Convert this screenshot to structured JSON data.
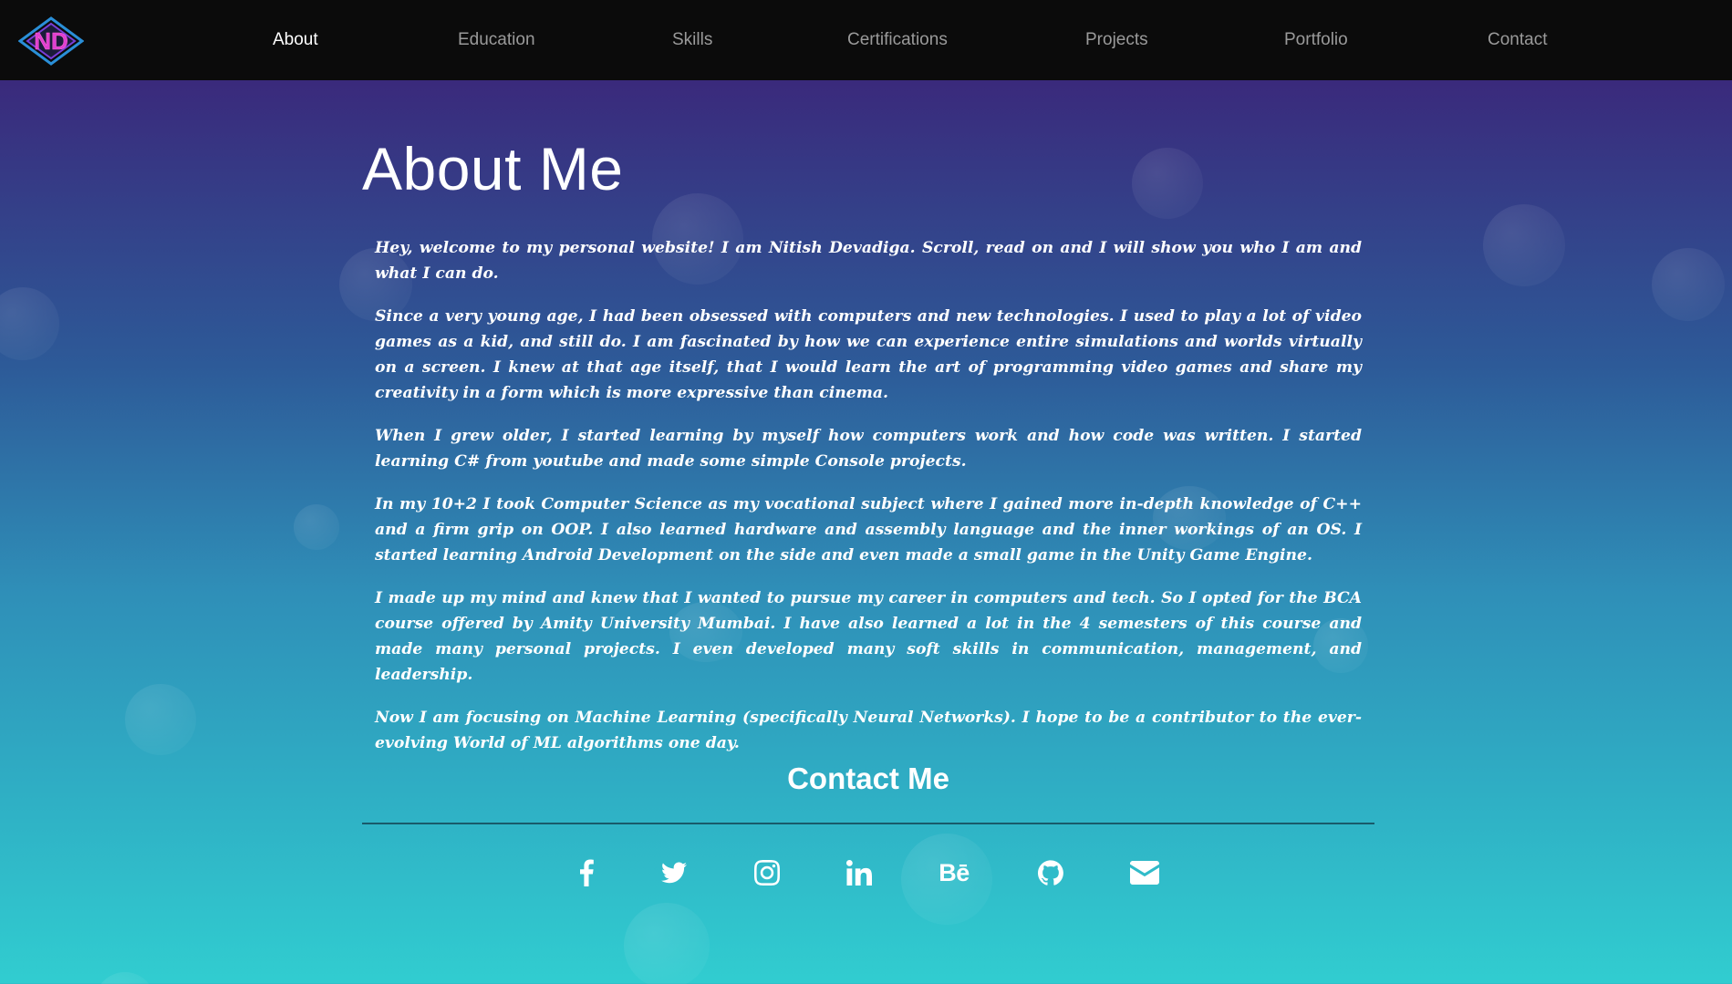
{
  "nav": {
    "logo_text": "ND",
    "items": [
      {
        "label": "About",
        "active": true
      },
      {
        "label": "Education",
        "active": false
      },
      {
        "label": "Skills",
        "active": false
      },
      {
        "label": "Certifications",
        "active": false
      },
      {
        "label": "Projects",
        "active": false
      },
      {
        "label": "Portfolio",
        "active": false
      },
      {
        "label": "Contact",
        "active": false
      }
    ]
  },
  "about": {
    "title": "About Me",
    "paragraphs": [
      "Hey, welcome to my personal website! I am Nitish Devadiga. Scroll, read on and I will show you who I am and what I can do.",
      "Since a very young age, I had been obsessed with computers and new technologies. I used to play a lot of video games as a kid, and still do. I am fascinated by how we can experience entire simulations and worlds virtually on a screen. I knew at that age itself, that I would learn the art of programming video games and share my creativity in a form which is more expressive than cinema.",
      "When I grew older, I started learning by myself how computers work and how code was written. I started learning C# from youtube and made some simple Console projects.",
      "In my 10+2 I took Computer Science as my vocational subject where I gained more in-depth knowledge of C++ and a firm grip on OOP. I also learned hardware and assembly language and the inner workings of an OS. I started learning Android Development on the side and even made a small game in the Unity Game Engine.",
      "I made up my mind and knew that I wanted to pursue my career in computers and tech. So I opted for the BCA course offered by Amity University Mumbai. I have also learned a lot in the 4 semesters of this course and made many personal projects. I even developed many soft skills in communication, management, and leadership.",
      "Now I am focusing on Machine Learning (specifically Neural Networks). I hope to be a contributor to the ever-evolving World of ML algorithms one day."
    ]
  },
  "contact": {
    "title": "Contact Me",
    "socials": [
      {
        "name": "facebook-icon"
      },
      {
        "name": "twitter-icon"
      },
      {
        "name": "instagram-icon"
      },
      {
        "name": "linkedin-icon"
      },
      {
        "name": "behance-icon",
        "text": "Bē"
      },
      {
        "name": "github-icon"
      },
      {
        "name": "email-icon"
      }
    ]
  },
  "colors": {
    "nav_bg": "#0b0b0b",
    "gradient_top": "#3a1a72",
    "gradient_bottom": "#31cdd0",
    "logo_pink": "#e040d0",
    "logo_blue": "#2a8fd8"
  }
}
